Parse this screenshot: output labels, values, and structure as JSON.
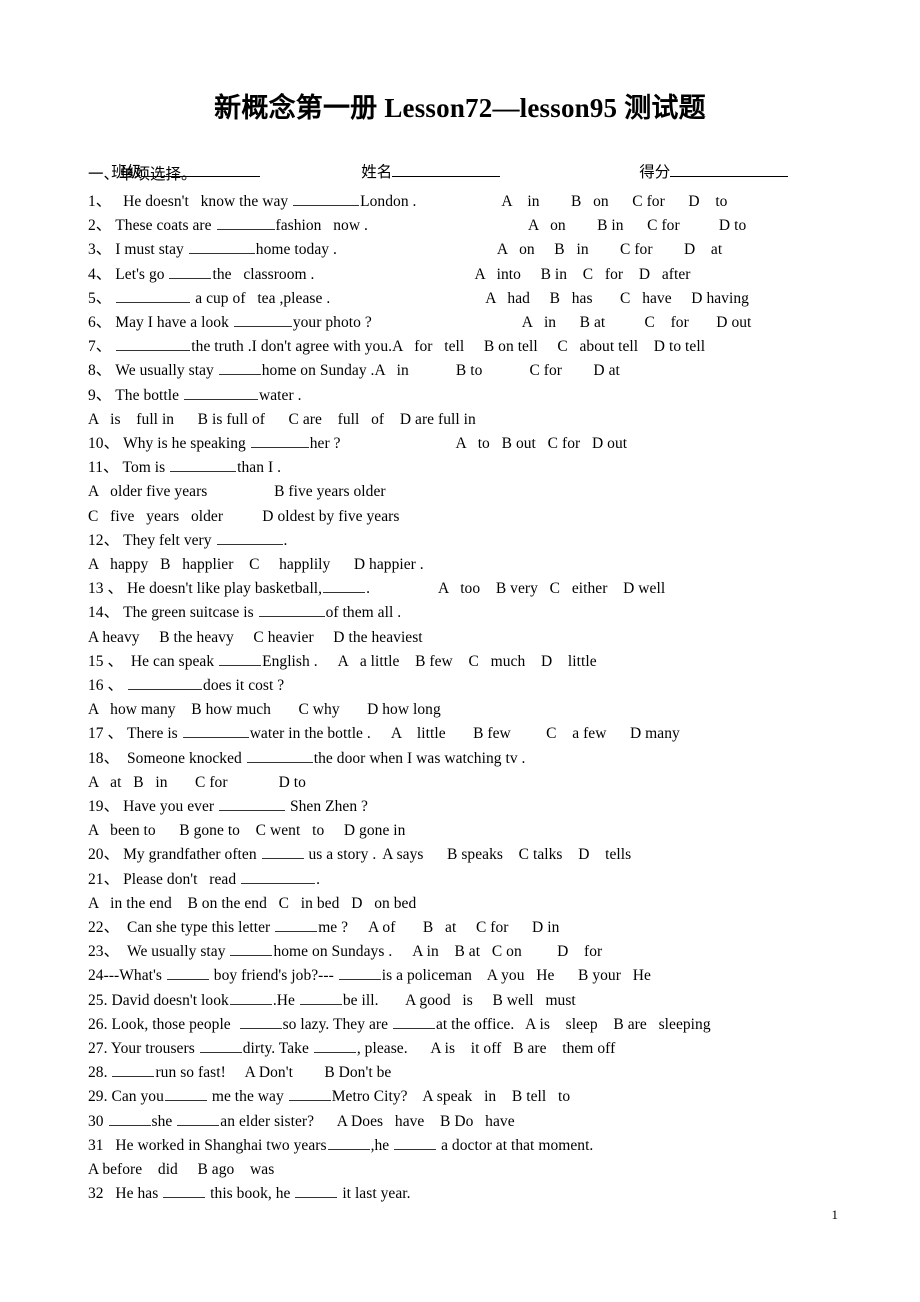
{
  "document": {
    "title": "新概念第一册 Lesson72—lesson95 测试题",
    "page_number": "1"
  },
  "header": {
    "class_label": "班级",
    "name_label": "姓名",
    "score_label": "得分"
  },
  "section": {
    "heading": "一、单项选择。"
  },
  "questions": [
    {
      "id": "q1",
      "num": "1、",
      "stem_before": "   He doesn't   know the way ",
      "blank": "b8",
      "stem_after": "London .",
      "options": "    A    in        B   on      C for      D    to",
      "opt_gap": 70
    },
    {
      "id": "q2",
      "num": "2、",
      "stem_before": " These coats are ",
      "blank": "b7",
      "stem_after": "fashion   now .",
      "options": "A   on        B in      C for          D to",
      "opt_gap": 160
    },
    {
      "id": "q3",
      "num": "3、",
      "stem_before": " I must stay ",
      "blank": "b8",
      "stem_after": "home today .",
      "options": "A   on     B   in        C for        D    at",
      "opt_gap": 160
    },
    {
      "id": "q4",
      "num": "4、",
      "stem_before": " Let's go ",
      "blank": "b5",
      "stem_after": "the   classroom .",
      "options": "A   into     B in    C   for    D   after",
      "opt_gap": 160
    },
    {
      "id": "q5",
      "num": "5、",
      "stem_before": " ",
      "blank": "b9",
      "stem_after": " a cup of   tea ,please .",
      "options": "A   had     B   has       C   have     D having",
      "opt_gap": 155
    },
    {
      "id": "q6",
      "num": "6、",
      "stem_before": " May I have a look ",
      "blank": "b7",
      "stem_after": "your photo ?",
      "options": "A   in      B at          C    for       D out",
      "opt_gap": 150
    },
    {
      "id": "q7",
      "num": "7、",
      "stem_before": " ",
      "blank": "b9",
      "stem_after": "the truth .I don't agree with you.",
      "options": "A   for   tell     B on tell     C   about tell    D to tell",
      "opt_gap": 0
    },
    {
      "id": "q8",
      "num": "8、",
      "stem_before": " We usually stay ",
      "blank": "b5",
      "stem_after": "home on Sunday .",
      "options": "A   in            B to            C for        D at",
      "opt_gap": 0
    },
    {
      "id": "q9",
      "num": "9、",
      "stem_before": " The bottle ",
      "blank": "b9",
      "stem_after": "water .",
      "options": "",
      "opt_gap": 0
    },
    {
      "id": "q9opts",
      "num": "",
      "stem_before": "A   is    full in      B is full of      C are    full   of    D are full in",
      "blank": "",
      "stem_after": "",
      "options": "",
      "opt_gap": 0
    },
    {
      "id": "q10",
      "num": "10、",
      "stem_before": " Why is he speaking ",
      "blank": "b7",
      "stem_after": "her ?",
      "options": "A   to   B out   C for   D out",
      "opt_gap": 115
    },
    {
      "id": "q11",
      "num": "11、",
      "stem_before": " Tom is ",
      "blank": "b8",
      "stem_after": "than I .",
      "options": "",
      "opt_gap": 0
    },
    {
      "id": "q11a",
      "num": "",
      "stem_before": "A   older five years                 B five years older",
      "blank": "",
      "stem_after": "",
      "options": "",
      "opt_gap": 0
    },
    {
      "id": "q11b",
      "num": "",
      "stem_before": "C   five   years   older          D oldest by five years",
      "blank": "",
      "stem_after": "",
      "options": "",
      "opt_gap": 0
    },
    {
      "id": "q12",
      "num": "12、",
      "stem_before": " They felt very ",
      "blank": "b8",
      "stem_after": ".",
      "options": "",
      "opt_gap": 0
    },
    {
      "id": "q12a",
      "num": "",
      "stem_before": "A   happy   B   happlier    C     happlily      D happier .",
      "blank": "",
      "stem_after": "",
      "options": "",
      "opt_gap": 0
    },
    {
      "id": "q13",
      "num": "13 、",
      "stem_before": " He doesn't like play basketball,",
      "blank": "b5",
      "stem_after": ".",
      "options": "A   too    B very   C   either    D well",
      "opt_gap": 68
    },
    {
      "id": "q14",
      "num": "14、",
      "stem_before": " The green suitcase is ",
      "blank": "b8",
      "stem_after": "of them all .",
      "options": "",
      "opt_gap": 0
    },
    {
      "id": "q14a",
      "num": "",
      "stem_before": "A heavy     B the heavy     C heavier     D the heaviest",
      "blank": "",
      "stem_after": "",
      "options": "",
      "opt_gap": 0
    },
    {
      "id": "q15",
      "num": "15 、",
      "stem_before": "  He can speak ",
      "blank": "b5",
      "stem_after": "English .",
      "options": "A   a little    B few    C   much    D    little",
      "opt_gap": 20
    },
    {
      "id": "q16",
      "num": "16 、",
      "stem_before": " ",
      "blank": "b9",
      "stem_after": "does it cost ?",
      "options": "",
      "opt_gap": 0
    },
    {
      "id": "q16a",
      "num": "",
      "stem_before": "A   how many    B how much       C why       D how long",
      "blank": "",
      "stem_after": "",
      "options": "",
      "opt_gap": 0
    },
    {
      "id": "q17",
      "num": "17 、",
      "stem_before": " There is ",
      "blank": "b8",
      "stem_after": "water in the bottle .",
      "options": "A    little       B few         C    a few      D many",
      "opt_gap": 20
    },
    {
      "id": "q18",
      "num": "18、",
      "stem_before": "  Someone knocked ",
      "blank": "b8",
      "stem_after": "the door when I was watching tv .",
      "options": "",
      "opt_gap": 0
    },
    {
      "id": "q18a",
      "num": "",
      "stem_before": "A   at   B   in       C for             D to",
      "blank": "",
      "stem_after": "",
      "options": "",
      "opt_gap": 0
    },
    {
      "id": "q19",
      "num": "19、",
      "stem_before": " Have you ever ",
      "blank": "b8",
      "stem_after": " Shen Zhen ?",
      "options": "",
      "opt_gap": 0
    },
    {
      "id": "q19a",
      "num": "",
      "stem_before": "A   been to      B gone to    C went   to     D gone in",
      "blank": "",
      "stem_after": "",
      "options": "",
      "opt_gap": 0
    },
    {
      "id": "q20",
      "num": "20、",
      "stem_before": " My grandfather often ",
      "blank": "b5",
      "stem_after": " us a story .",
      "options": "A says      B speaks    C talks    D    tells",
      "opt_gap": 6
    },
    {
      "id": "q21",
      "num": "21、",
      "stem_before": " Please don't   read ",
      "blank": "b9",
      "stem_after": ".",
      "options": "",
      "opt_gap": 0
    },
    {
      "id": "q21a",
      "num": "",
      "stem_before": "A   in the end    B on the end   C   in bed   D   on bed",
      "blank": "",
      "stem_after": "",
      "options": "",
      "opt_gap": 0
    },
    {
      "id": "q22",
      "num": "22、",
      "stem_before": "  Can she type this letter ",
      "blank": "b5",
      "stem_after": "me ?",
      "options": "A of       B   at     C for      D in",
      "opt_gap": 20
    },
    {
      "id": "q23",
      "num": "23、",
      "stem_before": "  We usually stay ",
      "blank": "b5",
      "stem_after": "home on Sundays .",
      "options": "A in    B at   C on         D    for",
      "opt_gap": 20
    },
    {
      "id": "q24",
      "num": "24",
      "stem_before": "---What's ",
      "blank": "b5",
      "stem_after": " boy friend's job?--- ",
      "options": "is a policeman    A you   He      B your   He",
      "opt_gap": 0,
      "second_blank": "b5"
    },
    {
      "id": "q25",
      "num": "25.",
      "stem_before": " David doesn't look",
      "blank": "b5",
      "stem_after": ".He ",
      "options": "be ill.       A good   is     B well   must",
      "opt_gap": 0,
      "second_blank": "b5"
    },
    {
      "id": "q26",
      "num": "26.",
      "stem_before": " Look, those people  ",
      "blank": "b5",
      "stem_after": "so lazy. They are ",
      "options": "at the office.   A is    sleep    B are   sleeping",
      "opt_gap": 0,
      "second_blank": "b5"
    },
    {
      "id": "q27",
      "num": "27.",
      "stem_before": " Your trousers ",
      "blank": "b5",
      "stem_after": "dirty. Take ",
      "options": ", please.      A is    it off   B are    them off",
      "opt_gap": 0,
      "second_blank": "b5"
    },
    {
      "id": "q28",
      "num": "28.",
      "stem_before": " ",
      "blank": "b5",
      "stem_after": "run so fast!     A Don't        B Don't be",
      "options": "",
      "opt_gap": 0
    },
    {
      "id": "q29",
      "num": "29.",
      "stem_before": " Can you",
      "blank": "b5",
      "stem_after": " me the way ",
      "options": "Metro City?    A speak   in    B tell   to",
      "opt_gap": 0,
      "second_blank": "b5"
    },
    {
      "id": "q30",
      "num": "30",
      "stem_before": " ",
      "blank": "b5",
      "stem_after": "she ",
      "options": "an elder sister?      A Does   have    B Do   have",
      "opt_gap": 0,
      "second_blank": "b5"
    },
    {
      "id": "q31",
      "num": "31",
      "stem_before": "   He worked in Shanghai two years",
      "blank": "b5",
      "stem_after": ",he ",
      "options": " a doctor at that moment.",
      "opt_gap": 0,
      "second_blank": "b5"
    },
    {
      "id": "q31a",
      "num": "",
      "stem_before": "A before    did     B ago    was",
      "blank": "",
      "stem_after": "",
      "options": "",
      "opt_gap": 0
    },
    {
      "id": "q32",
      "num": "32",
      "stem_before": "   He has ",
      "blank": "b5",
      "stem_after": " this book, he ",
      "options": " it last year.",
      "opt_gap": 0,
      "second_blank": "b5"
    }
  ]
}
